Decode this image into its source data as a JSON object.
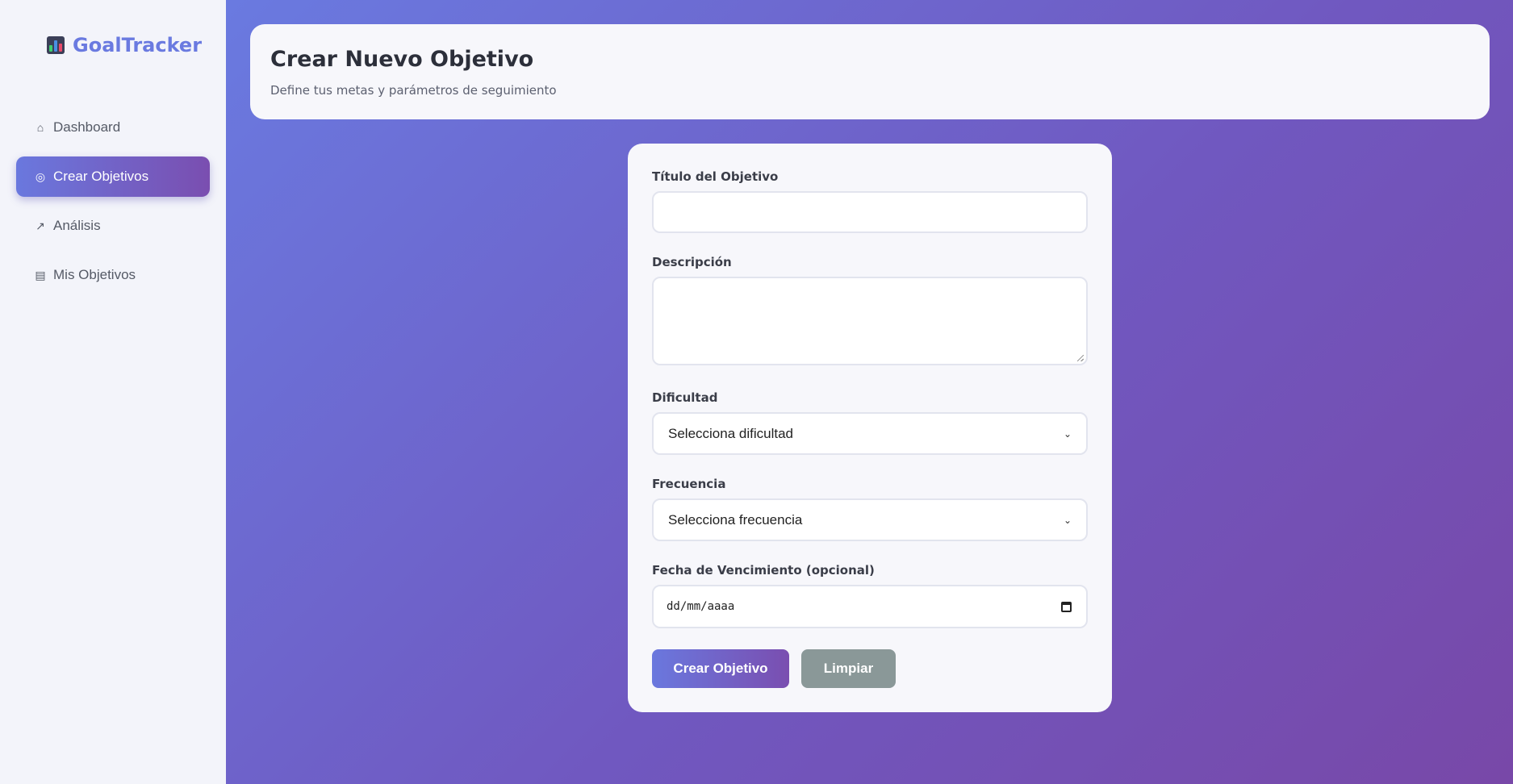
{
  "app": {
    "name": "GoalTracker",
    "logo_icon": "bar-chart-icon"
  },
  "sidebar": {
    "items": [
      {
        "label": "Dashboard",
        "icon": "house-icon",
        "active": false
      },
      {
        "label": "Crear Objetivos",
        "icon": "target-icon",
        "active": true
      },
      {
        "label": "Análisis",
        "icon": "line-chart-icon",
        "active": false
      },
      {
        "label": "Mis Objetivos",
        "icon": "clipboard-icon",
        "active": false
      }
    ]
  },
  "header": {
    "title": "Crear Nuevo Objetivo",
    "subtitle": "Define tus metas y parámetros de seguimiento"
  },
  "form": {
    "title_label": "Título del Objetivo",
    "title_value": "",
    "description_label": "Descripción",
    "description_value": "",
    "difficulty_label": "Dificultad",
    "difficulty_selected": "Selecciona dificultad",
    "frequency_label": "Frecuencia",
    "frequency_selected": "Selecciona frecuencia",
    "due_date_label": "Fecha de Vencimiento (opcional)",
    "due_date_placeholder": "dd/mm/aaaa",
    "submit_label": "Crear Objetivo",
    "clear_label": "Limpiar"
  },
  "colors": {
    "accent": "#6a7ae0",
    "accent_dark": "#7848a8",
    "secondary_button": "#8a9898"
  }
}
